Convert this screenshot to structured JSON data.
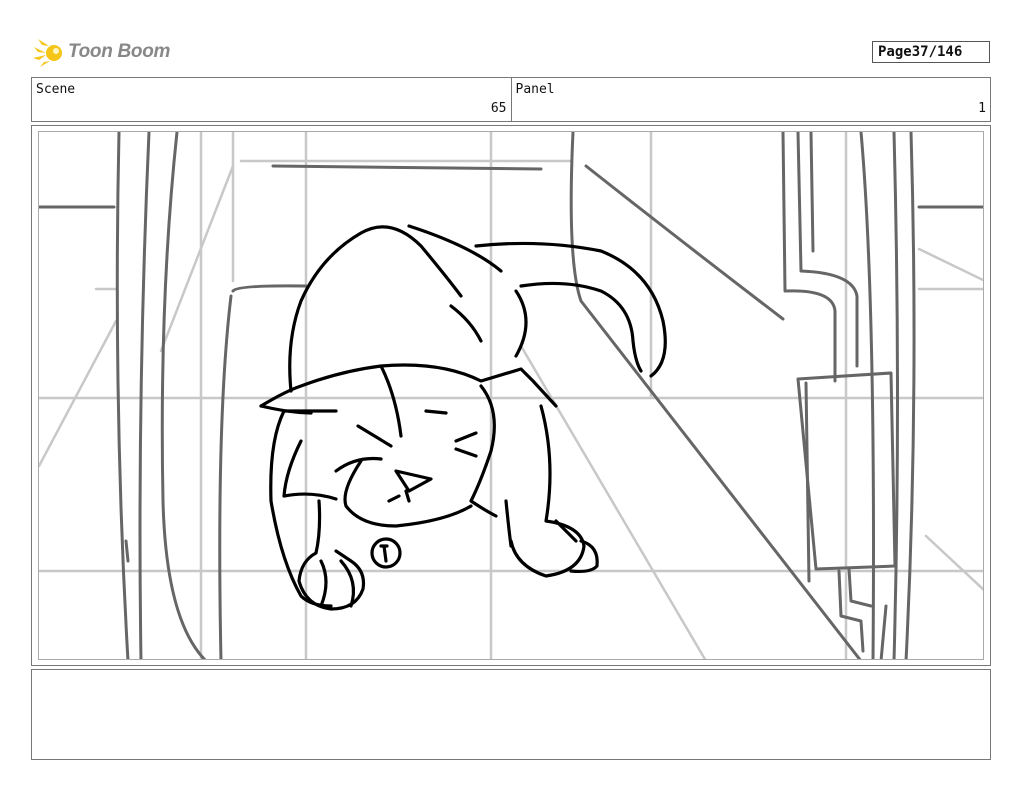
{
  "header": {
    "logo_text": "Toon Boom",
    "page_label": "Page",
    "page_value": "37/146"
  },
  "scene": {
    "label": "Scene",
    "value": "65"
  },
  "panel": {
    "label": "Panel",
    "value": "1"
  },
  "notes": {
    "text": ""
  },
  "colors": {
    "logo_accent": "#f5c518",
    "logo_text": "#888888",
    "sketch": "#000000",
    "guide": "#c8c8c8",
    "frame": "#666666"
  }
}
